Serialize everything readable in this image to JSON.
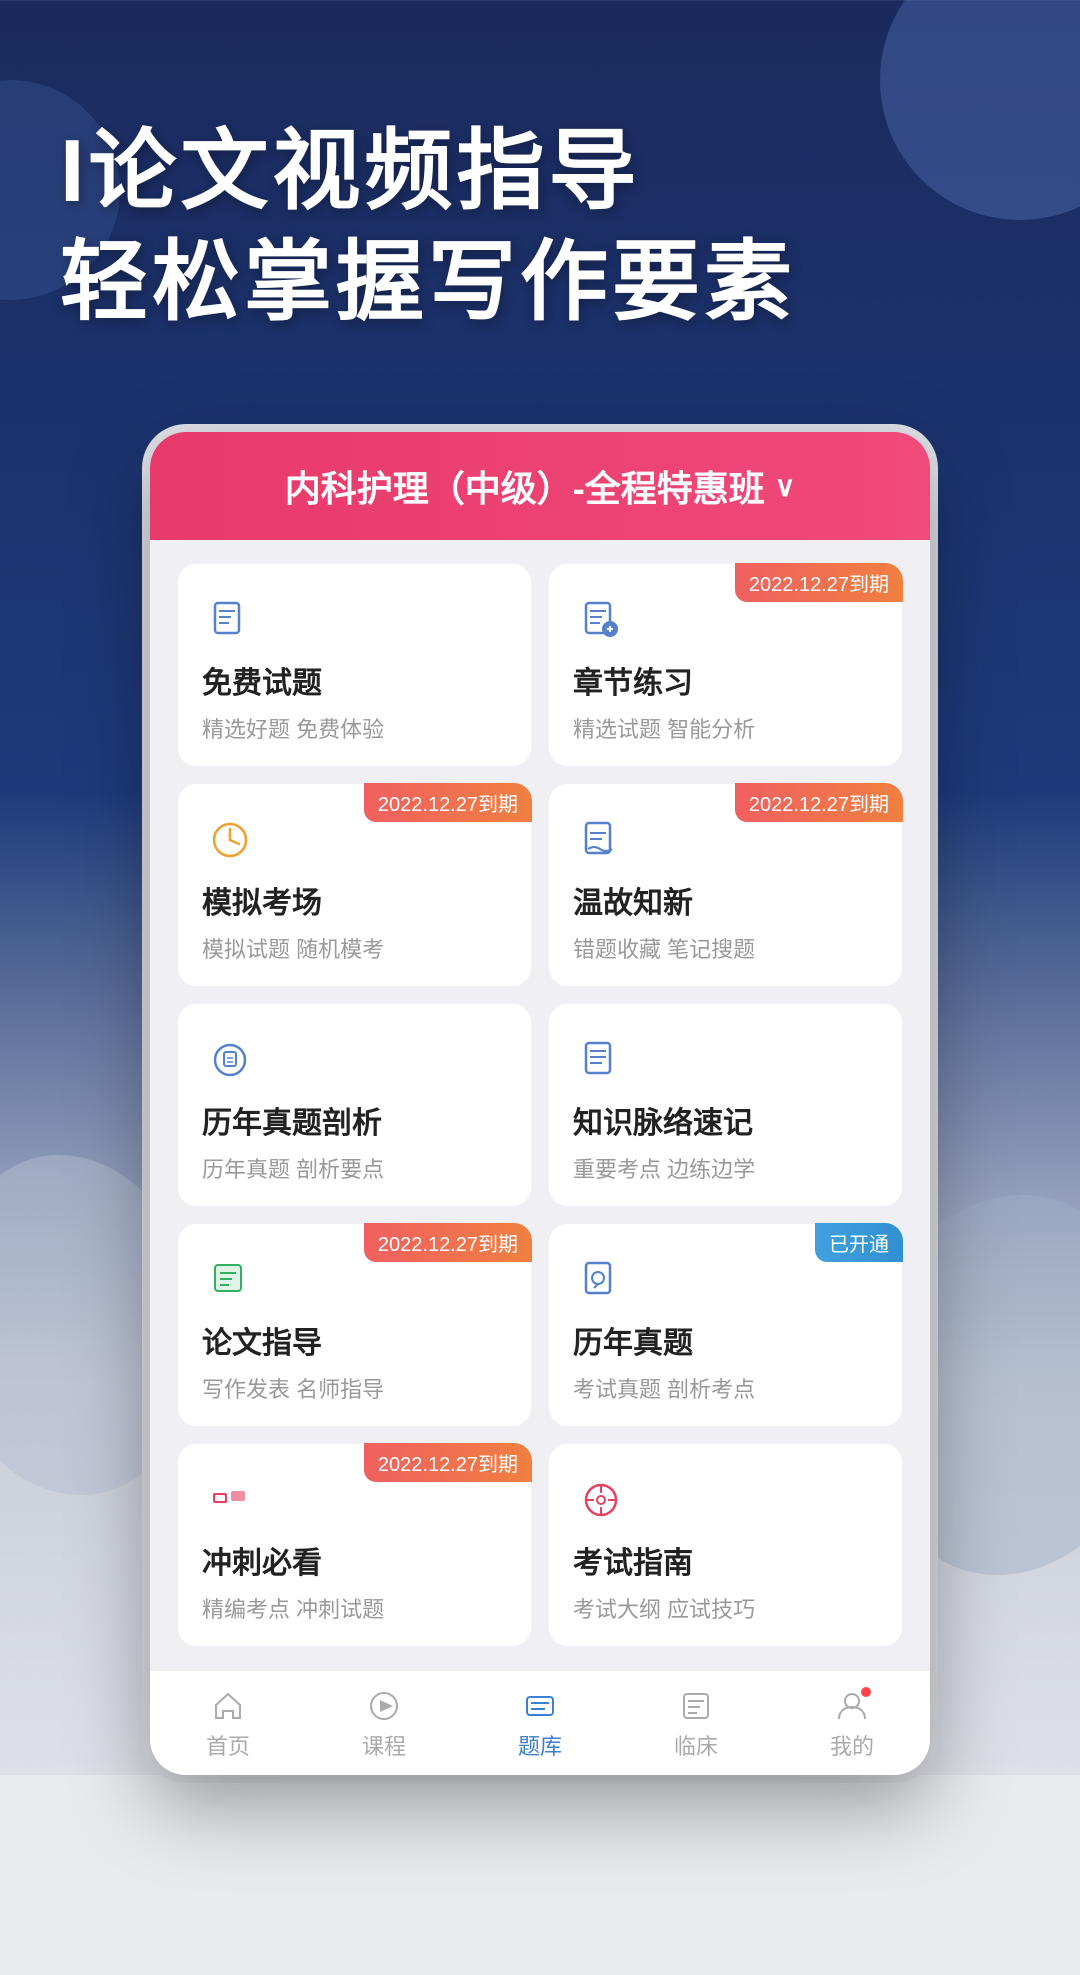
{
  "hero": {
    "line1": "I论文视频指导",
    "line2": "轻松掌握写作要素"
  },
  "app": {
    "header": {
      "course_title": "内科护理（中级）-全程特惠班",
      "chevron": "∨"
    },
    "cards": [
      {
        "id": "free-questions",
        "name": "免费试题",
        "desc": "精选好题 免费体验",
        "icon": "📄",
        "icon_type": "free",
        "badge": null
      },
      {
        "id": "chapter-practice",
        "name": "章节练习",
        "desc": "精选试题 智能分析",
        "icon": "📋",
        "icon_type": "chapter",
        "badge": "2022.12.27到期",
        "badge_type": "expiry"
      },
      {
        "id": "mock-exam",
        "name": "模拟考场",
        "desc": "模拟试题 随机模考",
        "icon": "⏰",
        "icon_type": "mock",
        "badge": "2022.12.27到期",
        "badge_type": "expiry"
      },
      {
        "id": "review",
        "name": "温故知新",
        "desc": "错题收藏 笔记搜题",
        "icon": "📝",
        "icon_type": "review",
        "badge": "2022.12.27到期",
        "badge_type": "expiry"
      },
      {
        "id": "history-analysis",
        "name": "历年真题剖析",
        "desc": "历年真题 剖析要点",
        "icon": "🎯",
        "icon_type": "history",
        "badge": null
      },
      {
        "id": "knowledge-map",
        "name": "知识脉络速记",
        "desc": "重要考点 边练边学",
        "icon": "📑",
        "icon_type": "knowledge",
        "badge": null
      },
      {
        "id": "essay-guide",
        "name": "论文指导",
        "desc": "写作发表 名师指导",
        "icon": "📰",
        "icon_type": "essay",
        "badge": "2022.12.27到期",
        "badge_type": "expiry"
      },
      {
        "id": "past-exams",
        "name": "历年真题",
        "desc": "考试真题 剖析考点",
        "icon": "📋",
        "icon_type": "past",
        "badge": "已开通",
        "badge_type": "opened"
      },
      {
        "id": "sprint",
        "name": "冲刺必看",
        "desc": "精编考点 冲刺试题",
        "icon": "🏷",
        "icon_type": "sprint",
        "badge": "2022.12.27到期",
        "badge_type": "expiry"
      },
      {
        "id": "exam-guide",
        "name": "考试指南",
        "desc": "考试大纲 应试技巧",
        "icon": "🧭",
        "icon_type": "guide",
        "badge": null
      }
    ],
    "nav": [
      {
        "id": "home",
        "label": "首页",
        "icon": "⌂",
        "active": false
      },
      {
        "id": "course",
        "label": "课程",
        "icon": "▷",
        "active": false
      },
      {
        "id": "questions",
        "label": "题库",
        "icon": "≡",
        "active": true
      },
      {
        "id": "clinical",
        "label": "临床",
        "icon": "📋",
        "active": false
      },
      {
        "id": "mine",
        "label": "我的",
        "icon": "○",
        "active": false,
        "has_notification": true
      }
    ]
  }
}
